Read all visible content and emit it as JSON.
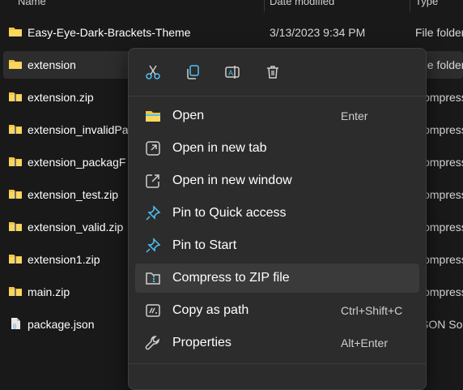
{
  "header": {
    "name": "Name",
    "date": "Date modified",
    "type": "Type"
  },
  "files": [
    {
      "name": "Easy-Eye-Dark-Brackets-Theme",
      "date": "3/13/2023 9:34 PM",
      "type": "File folder",
      "icon": "folder-icon"
    },
    {
      "name": "extension",
      "date": "",
      "type": "File folder",
      "icon": "folder-icon"
    },
    {
      "name": "extension.zip",
      "date": "",
      "type": "Compressed",
      "icon": "zip-folder-icon"
    },
    {
      "name": "extension_invalidPa",
      "date": "",
      "type": "Compressed",
      "icon": "zip-folder-icon"
    },
    {
      "name": "extension_packagF",
      "date": "",
      "type": "Compressed",
      "icon": "zip-folder-icon"
    },
    {
      "name": "extension_test.zip",
      "date": "",
      "type": "Compressed",
      "icon": "zip-folder-icon"
    },
    {
      "name": "extension_valid.zip",
      "date": "",
      "type": "Compressed",
      "icon": "zip-folder-icon"
    },
    {
      "name": "extension1.zip",
      "date": "",
      "type": "Compressed",
      "icon": "zip-folder-icon"
    },
    {
      "name": "main.zip",
      "date": "",
      "type": "Compressed",
      "icon": "zip-folder-icon"
    },
    {
      "name": "package.json",
      "date": "",
      "type": "JSON Sou",
      "icon": "json-file-icon"
    }
  ],
  "context_menu": {
    "toolbar": [
      {
        "name": "cut-icon"
      },
      {
        "name": "copy-icon"
      },
      {
        "name": "rename-icon"
      },
      {
        "name": "delete-icon"
      }
    ],
    "items": [
      {
        "label": "Open",
        "shortcut": "Enter",
        "icon": "folder-open-icon"
      },
      {
        "label": "Open in new tab",
        "shortcut": "",
        "icon": "new-tab-icon"
      },
      {
        "label": "Open in new window",
        "shortcut": "",
        "icon": "new-window-icon"
      },
      {
        "label": "Pin to Quick access",
        "shortcut": "",
        "icon": "pin-icon"
      },
      {
        "label": "Pin to Start",
        "shortcut": "",
        "icon": "pin-icon"
      },
      {
        "label": "Compress to ZIP file",
        "shortcut": "",
        "icon": "zip-compress-icon"
      },
      {
        "label": "Copy as path",
        "shortcut": "Ctrl+Shift+C",
        "icon": "copy-path-icon"
      },
      {
        "label": "Properties",
        "shortcut": "Alt+Enter",
        "icon": "wrench-icon"
      }
    ]
  },
  "colors": {
    "background": "#191919",
    "menu_background": "#2c2c2c",
    "accent_blue": "#4fc3f7",
    "folder_yellow": "#f4c542"
  }
}
